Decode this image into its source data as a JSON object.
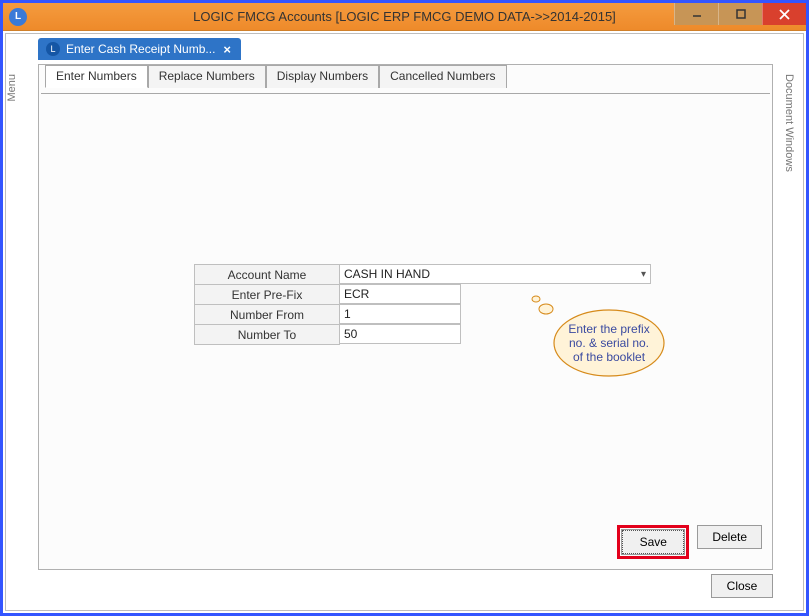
{
  "window": {
    "title": "LOGIC FMCG Accounts  [LOGIC ERP FMCG DEMO DATA->>2014-2015]"
  },
  "sidebars": {
    "left": "Menu",
    "right": "Document Windows"
  },
  "doc_tab": {
    "label": "Enter Cash Receipt Numb..."
  },
  "tabs": {
    "enter": "Enter Numbers",
    "replace": "Replace Numbers",
    "display": "Display Numbers",
    "cancelled": "Cancelled Numbers"
  },
  "form": {
    "account_name_label": "Account Name",
    "account_name_value": "CASH IN HAND",
    "prefix_label": "Enter Pre-Fix",
    "prefix_value": "ECR",
    "from_label": "Number From",
    "from_value": "1",
    "to_label": "Number To",
    "to_value": "50"
  },
  "callout": {
    "line1": "Enter the prefix",
    "line2": "no. & serial no.",
    "line3": "of the booklet"
  },
  "buttons": {
    "save": "Save",
    "delete": "Delete",
    "close": "Close"
  }
}
